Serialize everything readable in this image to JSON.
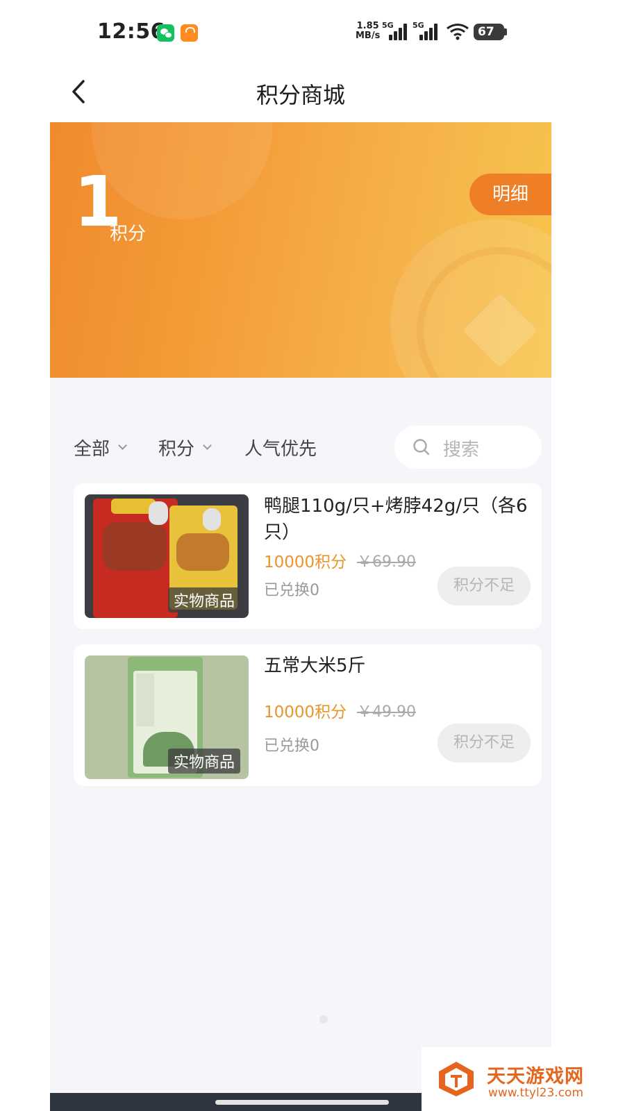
{
  "status_bar": {
    "time": "12:56",
    "net_speed_value": "1.85",
    "net_speed_unit": "MB/s",
    "sim1_label": "5G",
    "sim2_label": "5G",
    "battery": "67",
    "icons": [
      "wechat-icon",
      "shop-icon",
      "signal-icon",
      "wifi-icon",
      "battery-icon"
    ]
  },
  "nav": {
    "title": "积分商城",
    "back_icon": "chevron-left-icon"
  },
  "banner": {
    "points": "1",
    "points_unit": "积分",
    "detail_label": "明细",
    "colors": {
      "start": "#f08a2e",
      "end": "#f7c54d"
    }
  },
  "filters": {
    "all_label": "全部",
    "points_label": "积分",
    "popular_label": "人气优先",
    "search_placeholder": "搜索"
  },
  "products": [
    {
      "name": "鸭腿110g/只+烤脖42g/只（各6只）",
      "tag": "实物商品",
      "points_price": "10000积分",
      "original_price": "￥69.90",
      "redeemed": "已兑换0",
      "status": "积分不足"
    },
    {
      "name": "五常大米5斤",
      "tag": "实物商品",
      "points_price": "10000积分",
      "original_price": "￥49.90",
      "redeemed": "已兑换0",
      "status": "积分不足"
    }
  ],
  "watermark": {
    "name": "天天游戏网",
    "url": "www.ttyl23.com"
  },
  "accent_color": "#e8952a"
}
